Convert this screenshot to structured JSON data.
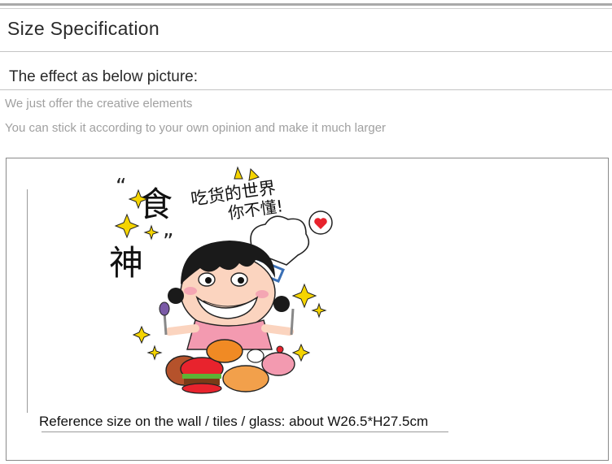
{
  "header": {
    "title": "Size Specification"
  },
  "intro": {
    "subtitle": "The effect as below picture:",
    "notes": [
      "We just offer the creative elements",
      "You can stick it according to your own opinion and make it much larger"
    ]
  },
  "preview": {
    "sticker_text": {
      "big_char_1": "食",
      "big_char_2": "神",
      "quote_open": "“",
      "quote_close": "”",
      "line_1": "吃货的世界",
      "line_2": "你不懂!"
    },
    "reference_size": "Reference size on the wall / tiles / glass: about W26.5*H27.5cm"
  },
  "colors": {
    "accent_red": "#e8232d",
    "star_yellow": "#f5d400",
    "skin": "#fbd4bf",
    "shirt_pink": "#f39ab0"
  }
}
